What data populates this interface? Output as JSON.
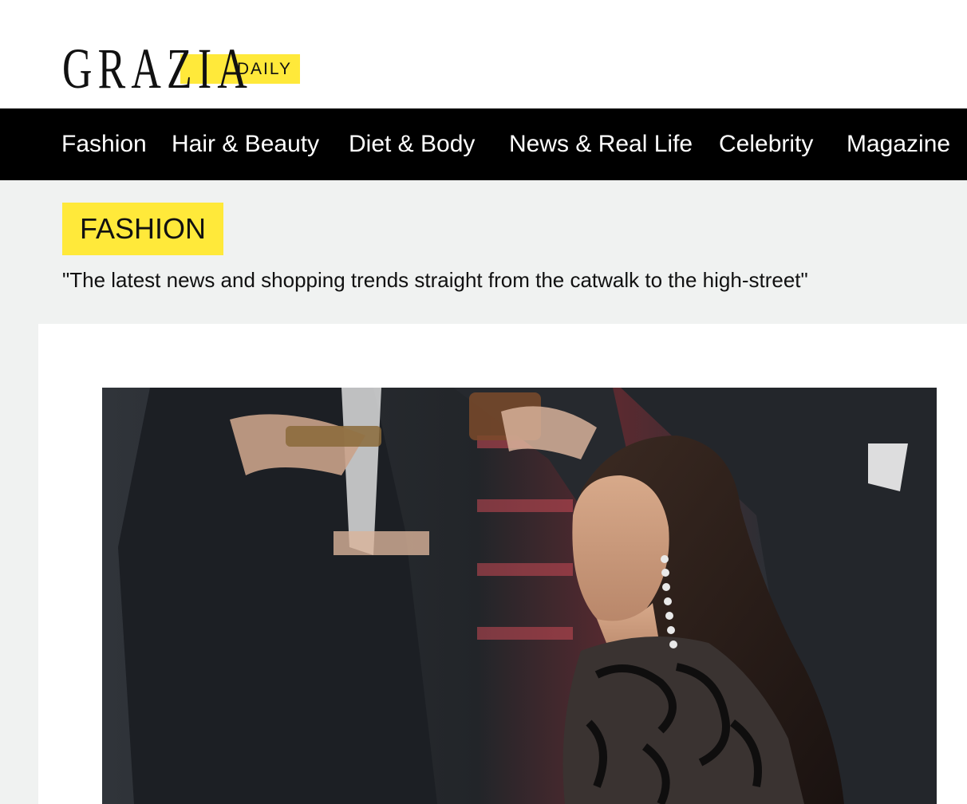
{
  "logo": {
    "wordmark": "GRAZIA",
    "badge": "DAILY"
  },
  "nav": [
    {
      "label": "Fashion"
    },
    {
      "label": "Hair & Beauty"
    },
    {
      "label": "Diet & Body"
    },
    {
      "label": "News & Real Life"
    },
    {
      "label": "Celebrity"
    },
    {
      "label": "Magazine"
    }
  ],
  "section": {
    "tag": "FASHION",
    "description": "\"The latest news and shopping trends straight from the catwalk to the high-street\""
  },
  "colors": {
    "accent": "#ffe93a",
    "nav_bg": "#000000",
    "page_bg": "#f0f2f1"
  }
}
